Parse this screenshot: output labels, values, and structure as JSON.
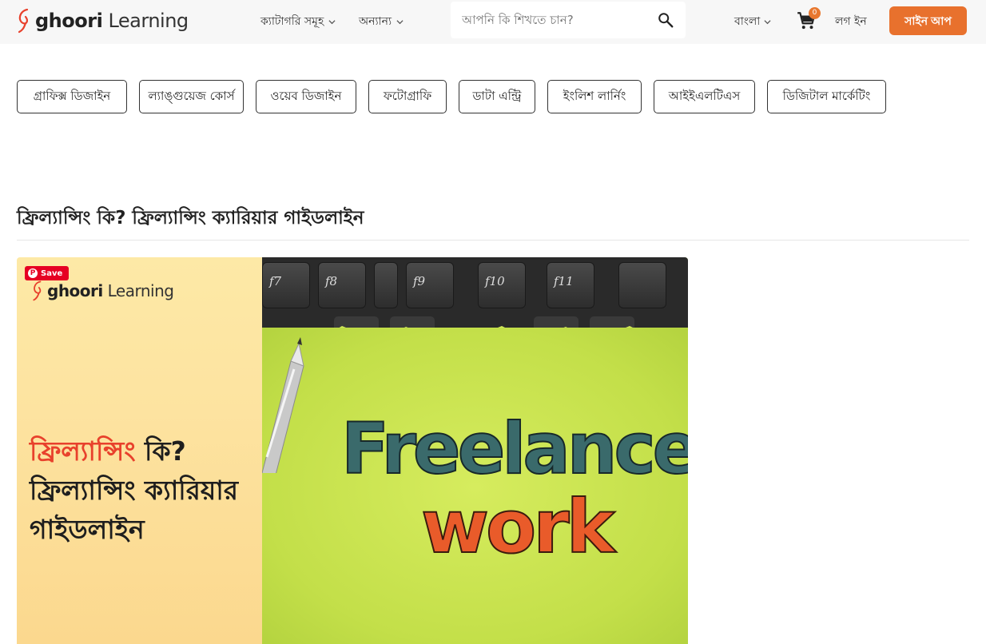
{
  "header": {
    "logo": {
      "brand": "ghoori",
      "suffix": "Learning"
    },
    "nav": [
      {
        "label": "ক্যাটাগরি সমূহ"
      },
      {
        "label": "অন্যান্য"
      }
    ],
    "search": {
      "placeholder": "আপনি কি শিখতে চান?"
    },
    "language": "বাংলা",
    "cart_count": "0",
    "login": "লগ ইন",
    "signup": "সাইন আপ"
  },
  "categories": [
    "গ্রাফিক্স ডিজাইন",
    "ল্যাঙ্গুয়েজ কোর্স",
    "ওয়েব ডিজাইন",
    "ফটোগ্রাফি",
    "ডাটা এন্ট্রি",
    "ইংলিশ লার্নিং",
    "আইইএলটিএস",
    "ডিজিটাল মার্কেটিং"
  ],
  "article": {
    "title": "ফ্রিল্যান্সিং কি? ফ্রিল্যান্সিং ক্যারিয়ার গাইডলাইন"
  },
  "feature_image": {
    "pin_save": "Save",
    "logo": {
      "brand": "ghoori",
      "suffix": "Learning"
    },
    "headline_highlight": "ফ্রিল্যান্সিং",
    "headline_q": " কি?",
    "headline_line2": "ফ্রিল্যান্সিং ক্যারিয়ার",
    "headline_line3": "গাইডলাইন",
    "keys": [
      "f7",
      "f8",
      "f9",
      "f10",
      "f11"
    ],
    "word1": "Freelance",
    "word2": "work"
  },
  "colors": {
    "accent": "#e8712d",
    "headline_red": "#e8412c"
  }
}
